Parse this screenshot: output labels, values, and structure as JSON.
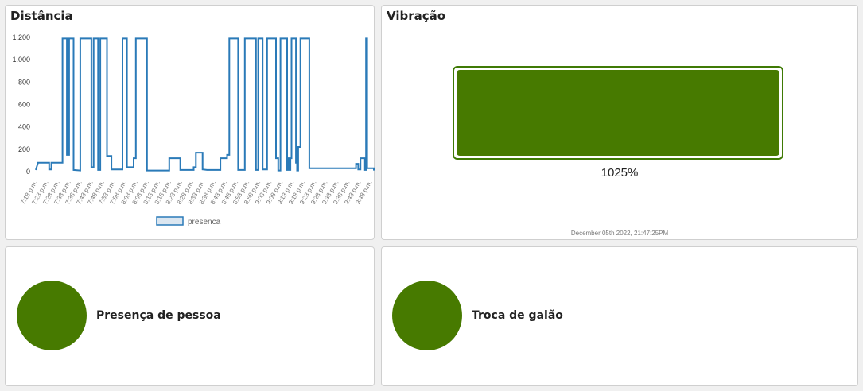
{
  "distancia": {
    "title": "Distância",
    "legend_label": "presenca",
    "series_color": "#2a7ab8"
  },
  "vibracao": {
    "title": "Vibração",
    "gauge_percent": 1025,
    "value_text": "1025%",
    "timestamp": "December 05th 2022, 21:47:25PM",
    "fill_color": "#477a00"
  },
  "presenca": {
    "label": "Presença de pessoa",
    "led_color": "#477a00"
  },
  "troca": {
    "label": "Troca de galão",
    "led_color": "#477a00"
  },
  "chart_data": {
    "type": "line",
    "title": "Distância",
    "legend": [
      "presenca"
    ],
    "ylim": [
      0,
      1200
    ],
    "y_ticks": [
      "0",
      "200",
      "400",
      "600",
      "800",
      "1.000",
      "1.200"
    ],
    "y_tick_values": [
      0,
      200,
      400,
      600,
      800,
      1000,
      1200
    ],
    "x_ticks": [
      "7:18 p.m.",
      "7:23 p.m.",
      "7:28 p.m.",
      "7:33 p.m.",
      "7:38 p.m.",
      "7:43 p.m.",
      "7:48 p.m.",
      "7:53 p.m.",
      "7:58 p.m.",
      "8:03 p.m.",
      "8:08 p.m.",
      "8:13 p.m.",
      "8:18 p.m.",
      "8:23 p.m.",
      "8:28 p.m.",
      "8:33 p.m.",
      "8:38 p.m.",
      "8:43 p.m.",
      "8:48 p.m.",
      "8:53 p.m.",
      "8:58 p.m.",
      "9:03 p.m.",
      "9:08 p.m.",
      "9:13 p.m.",
      "9:18 p.m.",
      "9:23 p.m.",
      "9:28 p.m.",
      "9:33 p.m.",
      "9:38 p.m.",
      "9:43 p.m.",
      "9:48 p.m."
    ],
    "x_min_minutes": 0,
    "x_max_minutes": 152,
    "series": [
      {
        "name": "presenca",
        "points": [
          [
            0,
            15
          ],
          [
            1,
            80
          ],
          [
            6,
            80
          ],
          [
            6,
            20
          ],
          [
            7,
            20
          ],
          [
            7,
            80
          ],
          [
            12,
            80
          ],
          [
            12,
            1190
          ],
          [
            14,
            1190
          ],
          [
            14,
            150
          ],
          [
            15,
            150
          ],
          [
            15,
            1190
          ],
          [
            17,
            1190
          ],
          [
            17,
            15
          ],
          [
            20,
            10
          ],
          [
            20,
            1190
          ],
          [
            25,
            1190
          ],
          [
            25,
            40
          ],
          [
            26,
            40
          ],
          [
            26,
            1190
          ],
          [
            28,
            1190
          ],
          [
            28,
            15
          ],
          [
            29,
            15
          ],
          [
            29,
            1190
          ],
          [
            32,
            1190
          ],
          [
            32,
            140
          ],
          [
            34,
            140
          ],
          [
            34,
            20
          ],
          [
            39,
            20
          ],
          [
            39,
            1190
          ],
          [
            41,
            1190
          ],
          [
            41,
            40
          ],
          [
            44,
            40
          ],
          [
            44,
            120
          ],
          [
            45,
            120
          ],
          [
            45,
            1190
          ],
          [
            50,
            1190
          ],
          [
            50,
            10
          ],
          [
            60,
            10
          ],
          [
            60,
            120
          ],
          [
            65,
            120
          ],
          [
            65,
            15
          ],
          [
            71,
            15
          ],
          [
            71,
            40
          ],
          [
            72,
            40
          ],
          [
            72,
            170
          ],
          [
            75,
            170
          ],
          [
            75,
            20
          ],
          [
            77,
            15
          ],
          [
            83,
            15
          ],
          [
            83,
            120
          ],
          [
            86,
            120
          ],
          [
            86,
            150
          ],
          [
            87,
            150
          ],
          [
            87,
            1190
          ],
          [
            91,
            1190
          ],
          [
            91,
            15
          ],
          [
            94,
            15
          ],
          [
            94,
            1190
          ],
          [
            99,
            1190
          ],
          [
            99,
            15
          ],
          [
            100,
            15
          ],
          [
            100,
            1190
          ],
          [
            102,
            1190
          ],
          [
            102,
            20
          ],
          [
            104,
            20
          ],
          [
            104,
            1190
          ],
          [
            108,
            1190
          ],
          [
            108,
            120
          ],
          [
            109,
            120
          ],
          [
            109,
            10
          ],
          [
            110,
            10
          ],
          [
            110,
            1190
          ],
          [
            113,
            1190
          ],
          [
            113,
            15
          ],
          [
            113.5,
            15
          ],
          [
            113.5,
            120
          ],
          [
            114,
            120
          ],
          [
            114,
            15
          ],
          [
            114.5,
            15
          ],
          [
            114.5,
            120
          ],
          [
            115,
            120
          ],
          [
            115,
            1190
          ],
          [
            117,
            1190
          ],
          [
            117,
            80
          ],
          [
            117.5,
            80
          ],
          [
            117.5,
            10
          ],
          [
            118,
            10
          ],
          [
            118,
            220
          ],
          [
            119,
            220
          ],
          [
            119,
            1190
          ],
          [
            123,
            1190
          ],
          [
            123,
            30
          ],
          [
            132,
            30
          ],
          [
            144,
            30
          ],
          [
            144,
            70
          ],
          [
            145,
            70
          ],
          [
            145,
            20
          ],
          [
            146,
            20
          ],
          [
            146,
            120
          ],
          [
            148,
            120
          ],
          [
            148,
            15
          ],
          [
            148.5,
            15
          ],
          [
            148.5,
            1190
          ],
          [
            149,
            1190
          ],
          [
            149,
            30
          ],
          [
            152,
            30
          ],
          [
            152,
            10
          ]
        ]
      }
    ]
  }
}
